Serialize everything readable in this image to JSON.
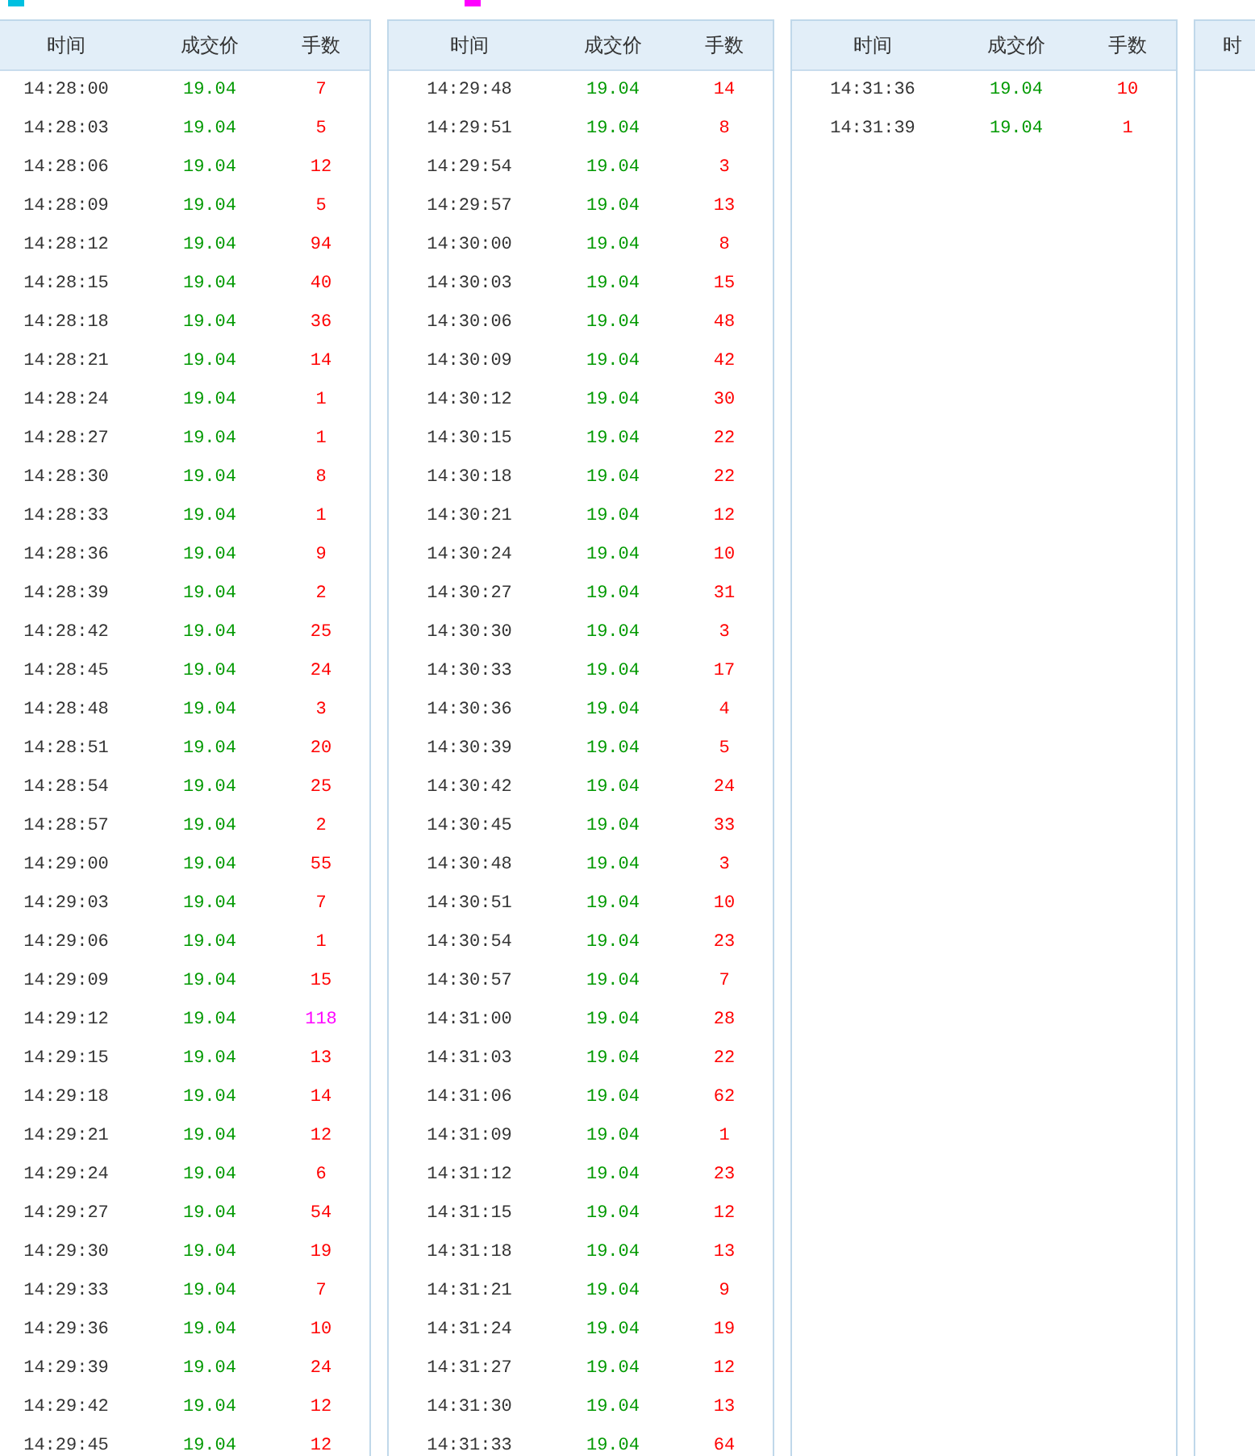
{
  "legend": [
    {
      "color": "#00c0e0"
    },
    {
      "color": "#ff00ff"
    }
  ],
  "panels": [
    {
      "columns": [
        "时间",
        "成交价",
        "手数"
      ],
      "rows": [
        {
          "time": "14:28:00",
          "price": "19.04",
          "volume": "7",
          "color": "#ff0000"
        },
        {
          "time": "14:28:03",
          "price": "19.04",
          "volume": "5",
          "color": "#ff0000"
        },
        {
          "time": "14:28:06",
          "price": "19.04",
          "volume": "12",
          "color": "#ff0000"
        },
        {
          "time": "14:28:09",
          "price": "19.04",
          "volume": "5",
          "color": "#ff0000"
        },
        {
          "time": "14:28:12",
          "price": "19.04",
          "volume": "94",
          "color": "#ff0000"
        },
        {
          "time": "14:28:15",
          "price": "19.04",
          "volume": "40",
          "color": "#ff0000"
        },
        {
          "time": "14:28:18",
          "price": "19.04",
          "volume": "36",
          "color": "#ff0000"
        },
        {
          "time": "14:28:21",
          "price": "19.04",
          "volume": "14",
          "color": "#ff0000"
        },
        {
          "time": "14:28:24",
          "price": "19.04",
          "volume": "1",
          "color": "#ff0000"
        },
        {
          "time": "14:28:27",
          "price": "19.04",
          "volume": "1",
          "color": "#ff0000"
        },
        {
          "time": "14:28:30",
          "price": "19.04",
          "volume": "8",
          "color": "#ff0000"
        },
        {
          "time": "14:28:33",
          "price": "19.04",
          "volume": "1",
          "color": "#ff0000"
        },
        {
          "time": "14:28:36",
          "price": "19.04",
          "volume": "9",
          "color": "#ff0000"
        },
        {
          "time": "14:28:39",
          "price": "19.04",
          "volume": "2",
          "color": "#ff0000"
        },
        {
          "time": "14:28:42",
          "price": "19.04",
          "volume": "25",
          "color": "#ff0000"
        },
        {
          "time": "14:28:45",
          "price": "19.04",
          "volume": "24",
          "color": "#ff0000"
        },
        {
          "time": "14:28:48",
          "price": "19.04",
          "volume": "3",
          "color": "#ff0000"
        },
        {
          "time": "14:28:51",
          "price": "19.04",
          "volume": "20",
          "color": "#ff0000"
        },
        {
          "time": "14:28:54",
          "price": "19.04",
          "volume": "25",
          "color": "#ff0000"
        },
        {
          "time": "14:28:57",
          "price": "19.04",
          "volume": "2",
          "color": "#ff0000"
        },
        {
          "time": "14:29:00",
          "price": "19.04",
          "volume": "55",
          "color": "#ff0000"
        },
        {
          "time": "14:29:03",
          "price": "19.04",
          "volume": "7",
          "color": "#ff0000"
        },
        {
          "time": "14:29:06",
          "price": "19.04",
          "volume": "1",
          "color": "#ff0000"
        },
        {
          "time": "14:29:09",
          "price": "19.04",
          "volume": "15",
          "color": "#ff0000"
        },
        {
          "time": "14:29:12",
          "price": "19.04",
          "volume": "118",
          "color": "#ff00ff"
        },
        {
          "time": "14:29:15",
          "price": "19.04",
          "volume": "13",
          "color": "#ff0000"
        },
        {
          "time": "14:29:18",
          "price": "19.04",
          "volume": "14",
          "color": "#ff0000"
        },
        {
          "time": "14:29:21",
          "price": "19.04",
          "volume": "12",
          "color": "#ff0000"
        },
        {
          "time": "14:29:24",
          "price": "19.04",
          "volume": "6",
          "color": "#ff0000"
        },
        {
          "time": "14:29:27",
          "price": "19.04",
          "volume": "54",
          "color": "#ff0000"
        },
        {
          "time": "14:29:30",
          "price": "19.04",
          "volume": "19",
          "color": "#ff0000"
        },
        {
          "time": "14:29:33",
          "price": "19.04",
          "volume": "7",
          "color": "#ff0000"
        },
        {
          "time": "14:29:36",
          "price": "19.04",
          "volume": "10",
          "color": "#ff0000"
        },
        {
          "time": "14:29:39",
          "price": "19.04",
          "volume": "24",
          "color": "#ff0000"
        },
        {
          "time": "14:29:42",
          "price": "19.04",
          "volume": "12",
          "color": "#ff0000"
        },
        {
          "time": "14:29:45",
          "price": "19.04",
          "volume": "12",
          "color": "#ff0000"
        }
      ]
    },
    {
      "columns": [
        "时间",
        "成交价",
        "手数"
      ],
      "rows": [
        {
          "time": "14:29:48",
          "price": "19.04",
          "volume": "14",
          "color": "#ff0000"
        },
        {
          "time": "14:29:51",
          "price": "19.04",
          "volume": "8",
          "color": "#ff0000"
        },
        {
          "time": "14:29:54",
          "price": "19.04",
          "volume": "3",
          "color": "#ff0000"
        },
        {
          "time": "14:29:57",
          "price": "19.04",
          "volume": "13",
          "color": "#ff0000"
        },
        {
          "time": "14:30:00",
          "price": "19.04",
          "volume": "8",
          "color": "#ff0000"
        },
        {
          "time": "14:30:03",
          "price": "19.04",
          "volume": "15",
          "color": "#ff0000"
        },
        {
          "time": "14:30:06",
          "price": "19.04",
          "volume": "48",
          "color": "#ff0000"
        },
        {
          "time": "14:30:09",
          "price": "19.04",
          "volume": "42",
          "color": "#ff0000"
        },
        {
          "time": "14:30:12",
          "price": "19.04",
          "volume": "30",
          "color": "#ff0000"
        },
        {
          "time": "14:30:15",
          "price": "19.04",
          "volume": "22",
          "color": "#ff0000"
        },
        {
          "time": "14:30:18",
          "price": "19.04",
          "volume": "22",
          "color": "#ff0000"
        },
        {
          "time": "14:30:21",
          "price": "19.04",
          "volume": "12",
          "color": "#ff0000"
        },
        {
          "time": "14:30:24",
          "price": "19.04",
          "volume": "10",
          "color": "#ff0000"
        },
        {
          "time": "14:30:27",
          "price": "19.04",
          "volume": "31",
          "color": "#ff0000"
        },
        {
          "time": "14:30:30",
          "price": "19.04",
          "volume": "3",
          "color": "#ff0000"
        },
        {
          "time": "14:30:33",
          "price": "19.04",
          "volume": "17",
          "color": "#ff0000"
        },
        {
          "time": "14:30:36",
          "price": "19.04",
          "volume": "4",
          "color": "#ff0000"
        },
        {
          "time": "14:30:39",
          "price": "19.04",
          "volume": "5",
          "color": "#ff0000"
        },
        {
          "time": "14:30:42",
          "price": "19.04",
          "volume": "24",
          "color": "#ff0000"
        },
        {
          "time": "14:30:45",
          "price": "19.04",
          "volume": "33",
          "color": "#ff0000"
        },
        {
          "time": "14:30:48",
          "price": "19.04",
          "volume": "3",
          "color": "#ff0000"
        },
        {
          "time": "14:30:51",
          "price": "19.04",
          "volume": "10",
          "color": "#ff0000"
        },
        {
          "time": "14:30:54",
          "price": "19.04",
          "volume": "23",
          "color": "#ff0000"
        },
        {
          "time": "14:30:57",
          "price": "19.04",
          "volume": "7",
          "color": "#ff0000"
        },
        {
          "time": "14:31:00",
          "price": "19.04",
          "volume": "28",
          "color": "#ff0000"
        },
        {
          "time": "14:31:03",
          "price": "19.04",
          "volume": "22",
          "color": "#ff0000"
        },
        {
          "time": "14:31:06",
          "price": "19.04",
          "volume": "62",
          "color": "#ff0000"
        },
        {
          "time": "14:31:09",
          "price": "19.04",
          "volume": "1",
          "color": "#ff0000"
        },
        {
          "time": "14:31:12",
          "price": "19.04",
          "volume": "23",
          "color": "#ff0000"
        },
        {
          "time": "14:31:15",
          "price": "19.04",
          "volume": "12",
          "color": "#ff0000"
        },
        {
          "time": "14:31:18",
          "price": "19.04",
          "volume": "13",
          "color": "#ff0000"
        },
        {
          "time": "14:31:21",
          "price": "19.04",
          "volume": "9",
          "color": "#ff0000"
        },
        {
          "time": "14:31:24",
          "price": "19.04",
          "volume": "19",
          "color": "#ff0000"
        },
        {
          "time": "14:31:27",
          "price": "19.04",
          "volume": "12",
          "color": "#ff0000"
        },
        {
          "time": "14:31:30",
          "price": "19.04",
          "volume": "13",
          "color": "#ff0000"
        },
        {
          "time": "14:31:33",
          "price": "19.04",
          "volume": "64",
          "color": "#ff0000"
        }
      ]
    },
    {
      "columns": [
        "时间",
        "成交价",
        "手数"
      ],
      "rows": [
        {
          "time": "14:31:36",
          "price": "19.04",
          "volume": "10",
          "color": "#ff0000"
        },
        {
          "time": "14:31:39",
          "price": "19.04",
          "volume": "1",
          "color": "#ff0000"
        }
      ]
    },
    {
      "columns": [
        "时"
      ]
    }
  ]
}
